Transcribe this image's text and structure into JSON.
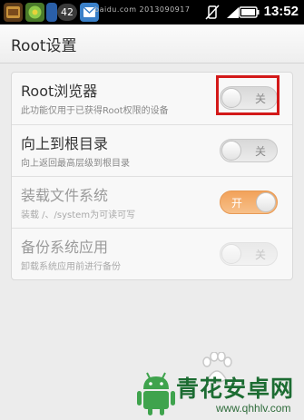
{
  "status_bar": {
    "badge": "42",
    "watermark": "baidu.com 2013090917",
    "time": "13:52"
  },
  "title_bar": {
    "title": "Root设置"
  },
  "settings": [
    {
      "title": "Root浏览器",
      "subtitle": "此功能仅用于已获得Root权限的设备",
      "toggle_label": "关",
      "state": "off",
      "enabled": true,
      "highlighted": true
    },
    {
      "title": "向上到根目录",
      "subtitle": "向上返回最高层级到根目录",
      "toggle_label": "关",
      "state": "off",
      "enabled": true,
      "highlighted": false
    },
    {
      "title": "装载文件系统",
      "subtitle": "装载 /、/system为可读可写",
      "toggle_label": "开",
      "state": "on",
      "enabled": false,
      "highlighted": false
    },
    {
      "title": "备份系统应用",
      "subtitle": "卸载系统应用前进行备份",
      "toggle_label": "关",
      "state": "off",
      "enabled": false,
      "highlighted": false
    }
  ],
  "watermark": {
    "brand_name": "青花安卓网",
    "url": "www.qhhlv.com"
  },
  "colors": {
    "status_bar_bg": "#000000",
    "toggle_on": "#f2a25a",
    "highlight": "#d31919",
    "brand_green": "#1c6c32"
  }
}
